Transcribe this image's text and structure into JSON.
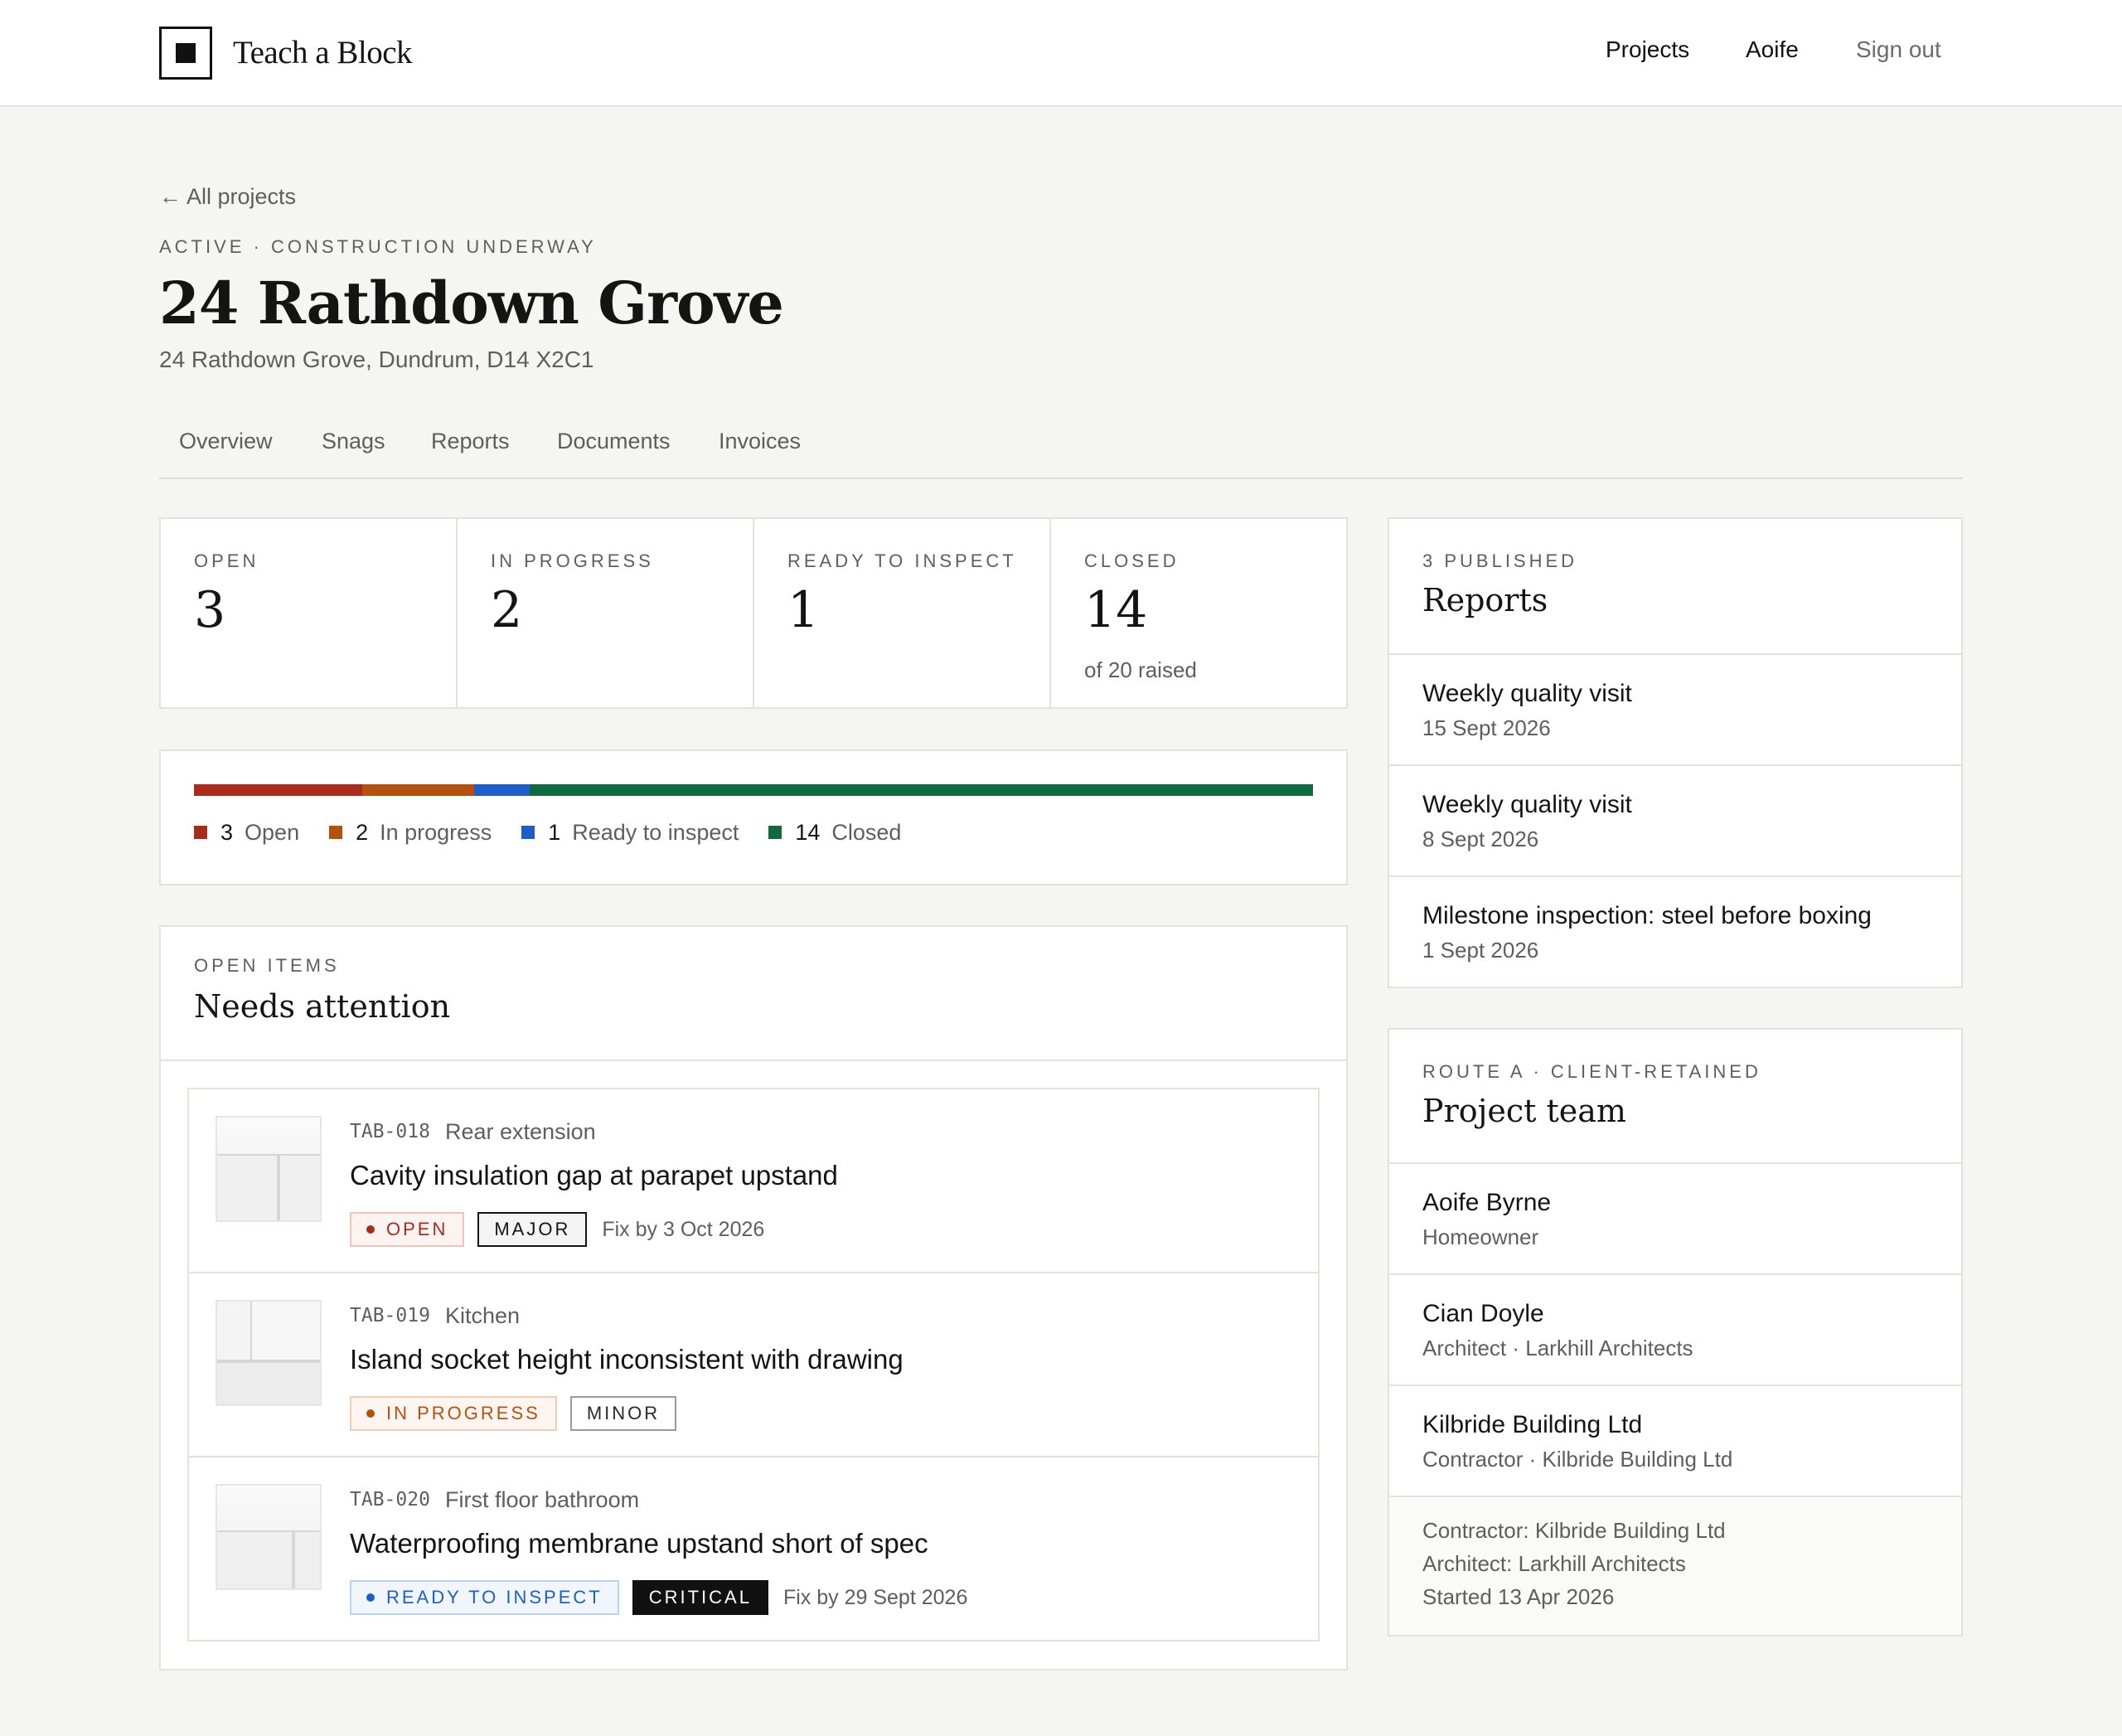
{
  "header": {
    "brand": "Teach a Block",
    "nav": {
      "projects": "Projects",
      "user": "Aoife",
      "sign_out": "Sign out"
    }
  },
  "page": {
    "back_link": "← All projects",
    "status": "Active · Construction underway",
    "title": "24 Rathdown Grove",
    "address": "24 Rathdown Grove, Dundrum, D14 X2C1"
  },
  "tabs": [
    "Overview",
    "Snags",
    "Reports",
    "Documents",
    "Invoices"
  ],
  "stats": {
    "open": {
      "label": "Open",
      "value": "3"
    },
    "in_progress": {
      "label": "In progress",
      "value": "2"
    },
    "ready": {
      "label": "Ready to inspect",
      "value": "1"
    },
    "closed": {
      "label": "Closed",
      "value": "14",
      "sub": "of 20 raised"
    }
  },
  "progress": {
    "total": 20,
    "segments": [
      {
        "count": "3",
        "value": 3,
        "label": "Open",
        "color": "#a82b1c"
      },
      {
        "count": "2",
        "value": 2,
        "label": "In progress",
        "color": "#b5510f"
      },
      {
        "count": "1",
        "value": 1,
        "label": "Ready to inspect",
        "color": "#1f5ec9"
      },
      {
        "count": "14",
        "value": 14,
        "label": "Closed",
        "color": "#0f6b3f"
      }
    ]
  },
  "attention": {
    "kicker": "Open items",
    "title": "Needs attention",
    "snags": [
      {
        "ref": "TAB-018",
        "location": "Rear extension",
        "title": "Cavity insulation gap at parapet upstand",
        "status": "Open",
        "severity": "Major",
        "fix_by": "Fix by 3 Oct 2026"
      },
      {
        "ref": "TAB-019",
        "location": "Kitchen",
        "title": "Island socket height inconsistent with drawing",
        "status": "In progress",
        "severity": "Minor",
        "fix_by": ""
      },
      {
        "ref": "TAB-020",
        "location": "First floor bathroom",
        "title": "Waterproofing membrane upstand short of spec",
        "status": "Ready to inspect",
        "severity": "Critical",
        "fix_by": "Fix by 29 Sept 2026"
      }
    ]
  },
  "reports": {
    "kicker": "3 published",
    "title": "Reports",
    "items": [
      {
        "title": "Weekly quality visit",
        "date": "15 Sept 2026"
      },
      {
        "title": "Weekly quality visit",
        "date": "8 Sept 2026"
      },
      {
        "title": "Milestone inspection: steel before boxing",
        "date": "1 Sept 2026"
      }
    ]
  },
  "team": {
    "kicker": "Route A · Client-retained",
    "title": "Project team",
    "members": [
      {
        "name": "Aoife Byrne",
        "role": "Homeowner"
      },
      {
        "name": "Cian Doyle",
        "role": "Architect · Larkhill Architects"
      },
      {
        "name": "Kilbride Building Ltd",
        "role": "Contractor · Kilbride Building Ltd"
      }
    ],
    "footer": {
      "contractor": "Contractor: Kilbride Building Ltd",
      "architect": "Architect: Larkhill Architects",
      "started": "Started 13 Apr 2026"
    }
  }
}
